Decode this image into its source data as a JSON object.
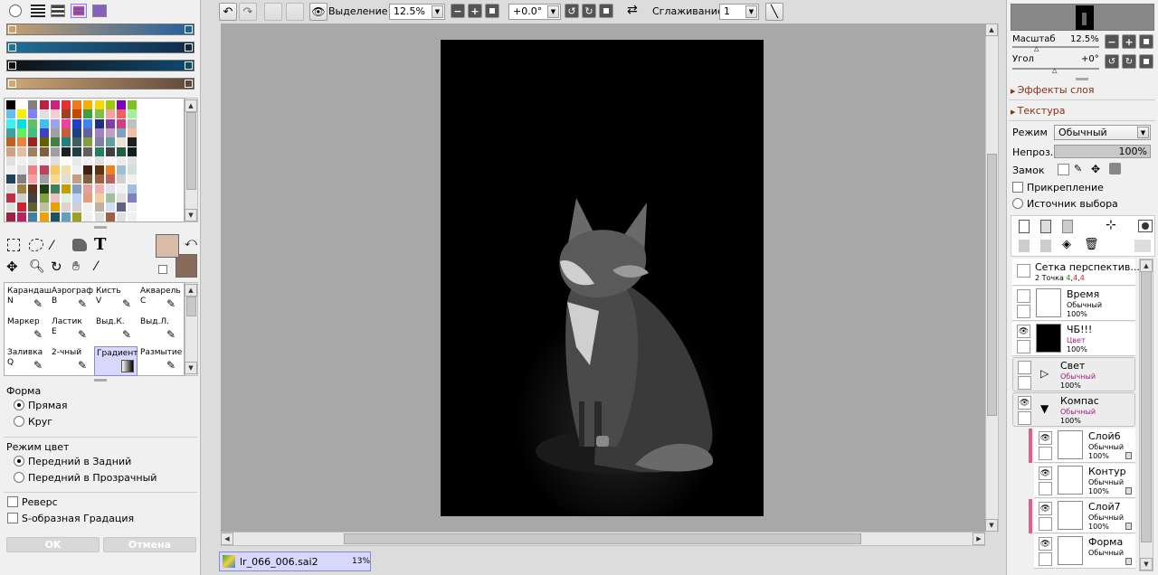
{
  "left": {
    "palette_mode_icons": [
      "circle-icon",
      "lines-icon",
      "bars-icon",
      "gradient-bars-icon",
      "grid-icon"
    ],
    "gradients": [
      {
        "from": "#c8a070",
        "to": "#2060a0"
      },
      {
        "from": "#207098",
        "to": "#102848"
      },
      {
        "from": "#101010",
        "to": "#104870"
      },
      {
        "from": "#d0a878",
        "to": "#604838"
      }
    ],
    "swatches": [
      "#000000",
      "#ffffff",
      "#808080",
      "#c02040",
      "#d02080",
      "#e83030",
      "#f07820",
      "#f8b000",
      "#f8d800",
      "#a0c800",
      "#8000c0",
      "#80c020",
      "#60c0f0",
      "#f8f000",
      "#8080ff",
      "#e0e0e0",
      "#f0d0d0",
      "#a04020",
      "#c84800",
      "#40a040",
      "#80c040",
      "#f8a0a0",
      "#f06060",
      "#a0f0a0",
      "#40f0f0",
      "#00e0e0",
      "#60c060",
      "#40c0f0",
      "#a0a0f0",
      "#f040a0",
      "#2040c0",
      "#4080f0",
      "#203080",
      "#8040a0",
      "#d04080",
      "#c0c0c0",
      "#40a0a0",
      "#60f060",
      "#40c080",
      "#4040c0",
      "#a0a0a0",
      "#c06040",
      "#204080",
      "#6060a0",
      "#a080c0",
      "#c0a0c0",
      "#80a0c0",
      "#f0c0a0",
      "#c06020",
      "#f08040",
      "#a02020",
      "#606000",
      "#408040",
      "#208080",
      "#406060",
      "#80a040",
      "#8080a0",
      "#60a0a0",
      "#f0e0d0",
      "#202020",
      "#d0a080",
      "#e0c0a0",
      "#a08060",
      "#806040",
      "#a0a0a0",
      "#202020",
      "#204040",
      "#606060",
      "#208060",
      "#404040",
      "#206040",
      "#102020",
      "#e0e0e0",
      "#f0f0f0",
      "#e8e8e8",
      "#f0f0f0",
      "#e0e0e0",
      "#ffffff",
      "#e8e8e8",
      "#f0f0f0",
      "#e0e0e0",
      "#f8f8f8",
      "#ececec",
      "#e0e0e0",
      "#f0f0f0",
      "#e0e0e0",
      "#f08080",
      "#c04060",
      "#f8c860",
      "#f0e0b0",
      "#f0f0f0",
      "#402010",
      "#603010",
      "#f08020",
      "#a0c0d0",
      "#d0e0e0",
      "#204060",
      "#808080",
      "#f8a0a0",
      "#a0a0a0",
      "#f8d890",
      "#e0e0d0",
      "#c0a080",
      "#806040",
      "#a06040",
      "#c06060",
      "#d0d0d0",
      "#f0f0f0",
      "#e0e0e0",
      "#a08040",
      "#603020",
      "#204010",
      "#408060",
      "#c0a000",
      "#80a0c0",
      "#e0a0a0",
      "#f0b0b0",
      "#e0e0f0",
      "#f0f0f0",
      "#a0c0e0",
      "#c03040",
      "#d0d0d0",
      "#404040",
      "#80a040",
      "#f0c0c0",
      "#e0f0e0",
      "#c0d0f0",
      "#e0a080",
      "#f0d0a0",
      "#a0c0a0",
      "#e0e0e0",
      "#8080c0",
      "#e0e0e0",
      "#d02030",
      "#606030",
      "#c0c0a0",
      "#e8a000",
      "#e0d0d0",
      "#d0d0d0",
      "#f0f0f0",
      "#c0b0a0",
      "#d0e0f0",
      "#606080",
      "#f0f0f0",
      "#a02040",
      "#c02060",
      "#4080a0",
      "#f0a000",
      "#205060",
      "#60a0c0",
      "#a0a020",
      "#f0f0f0",
      "#e0e0e0",
      "#a06040",
      "#e0e0e0",
      "#f0f0f0"
    ],
    "fg_color": "#d8bca8",
    "bg_color": "#8a6a5a",
    "tool_icons": [
      "marquee-icon",
      "lasso-icon",
      "magic-wand-icon",
      "bucket-icon",
      "text-icon",
      "move-icon",
      "zoom-icon",
      "rotate-icon",
      "hand-icon",
      "eyedropper-icon"
    ],
    "tools": [
      {
        "name": "Карандаш",
        "key": "N"
      },
      {
        "name": "Аэрограф",
        "key": "B"
      },
      {
        "name": "Кисть",
        "key": "V"
      },
      {
        "name": "Акварель",
        "key": "C"
      },
      {
        "name": "Маркер",
        "key": ""
      },
      {
        "name": "Ластик",
        "key": "E"
      },
      {
        "name": "Выд.К.",
        "key": ""
      },
      {
        "name": "Выд.Л.",
        "key": ""
      },
      {
        "name": "Заливка",
        "key": "Q"
      },
      {
        "name": "2-чный",
        "key": ""
      },
      {
        "name": "Градиент",
        "key": ""
      },
      {
        "name": "Размытие",
        "key": ""
      }
    ],
    "form_label": "Форма",
    "form_options": [
      "Прямая",
      "Круг"
    ],
    "color_mode_label": "Режим цвет",
    "color_mode_options": [
      "Передний в Задний",
      "Передний в Прозрачный"
    ],
    "reverse_label": "Реверс",
    "s_gradation_label": "S-образная Градация",
    "ok_label": "OK",
    "cancel_label": "Отмена"
  },
  "toolbar": {
    "selection_label": "Выделение",
    "zoom_value": "12.5%",
    "angle_value": "+0.0°",
    "smoothing_label": "Сглаживание",
    "smoothing_value": "1"
  },
  "canvas": {
    "tab_filename": "lr_066_006.sai2",
    "tab_zoom": "13%"
  },
  "right": {
    "scale_label": "Масштаб",
    "scale_value": "12.5%",
    "angle_label": "Угол",
    "angle_value": "+0°",
    "layer_effects_label": "Эффекты слоя",
    "texture_label": "Текстура",
    "mode_label": "Режим",
    "mode_value": "Обычный",
    "opacity_label": "Непроз.",
    "opacity_value": "100%",
    "lock_label": "Замок",
    "clipping_label": "Прикрепление",
    "selection_source_label": "Источник выбора",
    "perspective": {
      "name": "Сетка перспектив...",
      "sub": "2 Точка",
      "n1": "4",
      "n2": "4",
      "n3": "4"
    },
    "layers": [
      {
        "name": "Время",
        "mode": "Обычный",
        "pct": "100%",
        "eye": false,
        "thumb": "#ffffff",
        "group": false,
        "indent": 0,
        "pink": false,
        "mode_color": "#000"
      },
      {
        "name": "ЧБ!!!",
        "mode": "Цвет",
        "pct": "100%",
        "eye": true,
        "thumb": "#000000",
        "group": false,
        "indent": 0,
        "pink": false,
        "mode_color": "#a02080"
      },
      {
        "name": "Свет",
        "mode": "Обычный",
        "pct": "100%",
        "eye": false,
        "thumb": "",
        "group": true,
        "indent": 0,
        "pink": false,
        "mode_color": "#a02080"
      },
      {
        "name": "Компас",
        "mode": "Обычный",
        "pct": "100%",
        "eye": true,
        "thumb": "",
        "group": true,
        "indent": 0,
        "pink": false,
        "mode_color": "#a02080"
      },
      {
        "name": "Слой6",
        "mode": "Обычный",
        "pct": "100%",
        "eye": true,
        "thumb": "#ffffff",
        "group": false,
        "indent": 1,
        "pink": true,
        "mode_color": "#000"
      },
      {
        "name": "Контур",
        "mode": "Обычный",
        "pct": "100%",
        "eye": true,
        "thumb": "#ffffff",
        "group": false,
        "indent": 1,
        "pink": false,
        "mode_color": "#000"
      },
      {
        "name": "Слой7",
        "mode": "Обычный",
        "pct": "100%",
        "eye": true,
        "thumb": "#ffffff",
        "group": false,
        "indent": 1,
        "pink": true,
        "mode_color": "#000"
      },
      {
        "name": "Форма",
        "mode": "Обычный",
        "pct": "",
        "eye": true,
        "thumb": "#ffffff",
        "group": false,
        "indent": 1,
        "pink": false,
        "mode_color": "#000"
      }
    ]
  }
}
